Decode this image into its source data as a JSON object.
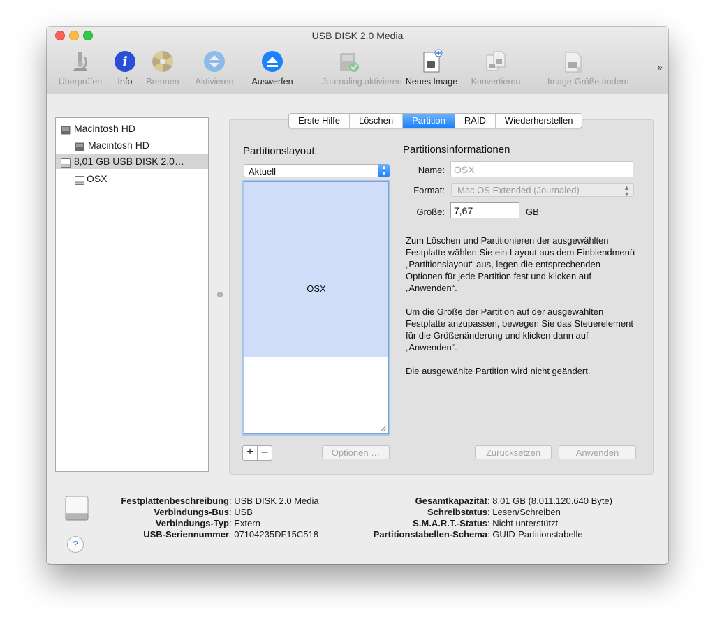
{
  "window": {
    "title": "USB DISK 2.0 Media"
  },
  "toolbar": {
    "items": [
      {
        "label": "Überprüfen",
        "icon": "microscope-icon",
        "enabled": false
      },
      {
        "label": "Info",
        "icon": "info-icon",
        "enabled": true
      },
      {
        "label": "Brennen",
        "icon": "burn-disc-icon",
        "enabled": false
      },
      {
        "label": "Aktivieren",
        "icon": "mount-icon",
        "enabled": false
      },
      {
        "label": "Auswerfen",
        "icon": "eject-icon",
        "enabled": true
      },
      {
        "label": "Journaling aktivieren",
        "icon": "journaling-icon",
        "enabled": false
      },
      {
        "label": "Neues Image",
        "icon": "new-image-icon",
        "enabled": true
      },
      {
        "label": "Konvertieren",
        "icon": "convert-icon",
        "enabled": false
      },
      {
        "label": "Image-Größe ändern",
        "icon": "resize-image-icon",
        "enabled": false
      }
    ],
    "overflow": "››"
  },
  "sidebar": {
    "items": [
      {
        "label": "Macintosh HD",
        "level": 0,
        "selected": false,
        "icon": "internal-disk-icon"
      },
      {
        "label": "Macintosh HD",
        "level": 1,
        "selected": false,
        "icon": "internal-volume-icon"
      },
      {
        "label": "8,01 GB USB DISK 2.0…",
        "level": 0,
        "selected": true,
        "icon": "external-disk-icon"
      },
      {
        "label": "OSX",
        "level": 1,
        "selected": false,
        "icon": "external-volume-icon"
      }
    ]
  },
  "tabs": [
    {
      "label": "Erste Hilfe",
      "active": false
    },
    {
      "label": "Löschen",
      "active": false
    },
    {
      "label": "Partition",
      "active": true
    },
    {
      "label": "RAID",
      "active": false
    },
    {
      "label": "Wiederherstellen",
      "active": false
    }
  ],
  "partition": {
    "layout_label": "Partitionslayout:",
    "layout_value": "Aktuell",
    "partitions": [
      {
        "name": "OSX",
        "fraction": 0.697
      }
    ],
    "add_label": "+",
    "remove_label": "–",
    "options_label": "Optionen …"
  },
  "info": {
    "heading": "Partitionsinformationen",
    "name_label": "Name:",
    "name_value": "OSX",
    "format_label": "Format:",
    "format_value": "Mac OS Extended (Journaled)",
    "size_label": "Größe:",
    "size_value": "7,67",
    "size_unit": "GB",
    "para1": "Zum Löschen und Partitionieren der ausgewählten Festplatte wählen Sie ein Layout aus dem Einblendmenü „Partitionslayout“ aus, legen die entsprechenden Optionen für jede Partition fest und klicken auf „Anwenden“.",
    "para2": "Um die Größe der Partition auf der ausgewählten Festplatte anzupassen, bewegen Sie das Steuerelement für die Größenänderung und klicken dann auf „Anwenden“.",
    "para3": "Die ausgewählte Partition wird nicht geändert.",
    "reset_label": "Zurücksetzen",
    "apply_label": "Anwenden"
  },
  "footer": {
    "left": [
      {
        "key": "Festplattenbeschreibung",
        "value": "USB DISK 2.0 Media"
      },
      {
        "key": "Verbindungs-Bus",
        "value": "USB"
      },
      {
        "key": "Verbindungs-Typ",
        "value": "Extern"
      },
      {
        "key": "USB-Seriennummer",
        "value": "07104235DF15C518"
      }
    ],
    "right": [
      {
        "key": "Gesamtkapazität",
        "value": "8,01 GB (8.011.120.640 Byte)"
      },
      {
        "key": "Schreibstatus",
        "value": "Lesen/Schreiben"
      },
      {
        "key": "S.M.A.R.T.-Status",
        "value": "Nicht unterstützt"
      },
      {
        "key": "Partitionstabellen-Schema",
        "value": "GUID-Partitionstabelle"
      }
    ],
    "help_label": "?"
  },
  "colors": {
    "accent": "#1a82fb",
    "partition_fill": "#cfddf9",
    "selection": "#d4d4d4"
  }
}
